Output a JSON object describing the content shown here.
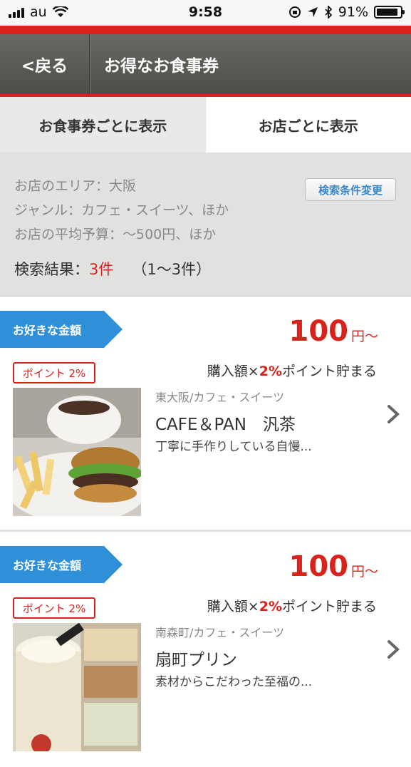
{
  "status_bar": {
    "carrier": "au",
    "time": "9:58",
    "battery": "91%",
    "battery_level": 0.91
  },
  "nav": {
    "back_label": "<戻る",
    "title": "お得なお食事券"
  },
  "tabs": [
    {
      "label": "お食事券ごとに表示",
      "active": true
    },
    {
      "label": "お店ごとに表示",
      "active": false
    }
  ],
  "conditions": {
    "area": "お店のエリア：大阪",
    "genre": "ジャンル：カフェ・スイーツ、ほか",
    "budget": "お店の平均予算：〜500円、ほか",
    "change_button": "検索条件変更",
    "result_label": "検索結果：",
    "result_count": "3件",
    "result_range": "（1〜3件）"
  },
  "items": [
    {
      "ribbon": "お好きな金額",
      "price": "100",
      "price_unit": "円〜",
      "point_badge": "ポイント 2%",
      "point_prefix": "購入額×",
      "point_pct": "2%",
      "point_suffix": "ポイント貯まる",
      "category": "東大阪/カフェ・スイーツ",
      "name": "CAFE＆PAN　汎茶",
      "description": "丁寧に手作りしている自慢..."
    },
    {
      "ribbon": "お好きな金額",
      "price": "100",
      "price_unit": "円〜",
      "point_badge": "ポイント 2%",
      "point_prefix": "購入額×",
      "point_pct": "2%",
      "point_suffix": "ポイント貯まる",
      "category": "南森町/カフェ・スイーツ",
      "name": "扇町プリン",
      "description": "素材からこだわった至福の..."
    }
  ],
  "colors": {
    "accent_red": "#d8231c",
    "ribbon_blue": "#2f8fd8",
    "link_blue": "#3a87c8"
  }
}
